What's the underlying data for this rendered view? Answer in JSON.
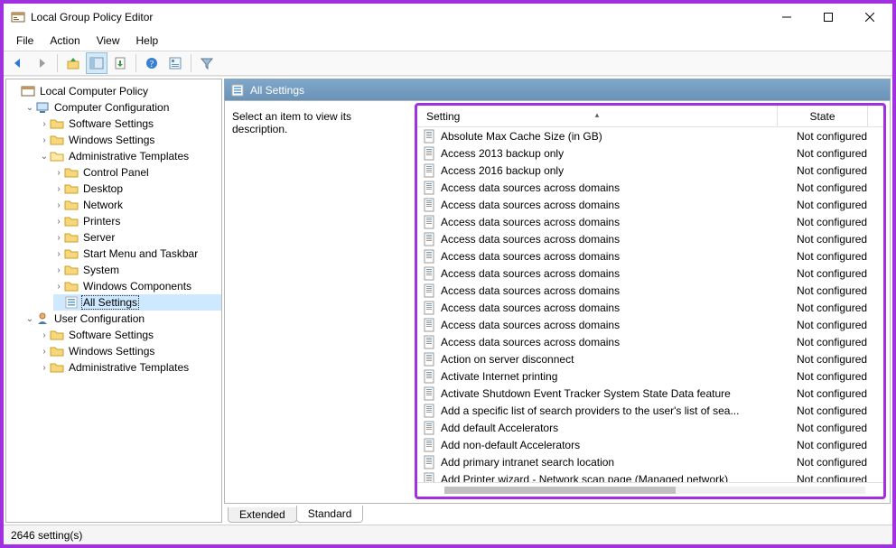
{
  "window": {
    "title": "Local Group Policy Editor"
  },
  "menu": [
    "File",
    "Action",
    "View",
    "Help"
  ],
  "tree": {
    "root": "Local Computer Policy",
    "cc": {
      "label": "Computer Configuration",
      "software": "Software Settings",
      "windows": "Windows Settings",
      "admin": {
        "label": "Administrative Templates",
        "children": [
          "Control Panel",
          "Desktop",
          "Network",
          "Printers",
          "Server",
          "Start Menu and Taskbar",
          "System",
          "Windows Components"
        ],
        "allsettings": "All Settings"
      }
    },
    "uc": {
      "label": "User Configuration",
      "software": "Software Settings",
      "windows": "Windows Settings",
      "admin": "Administrative Templates"
    }
  },
  "detail": {
    "header": "All Settings",
    "desc": "Select an item to view its description.",
    "col_setting": "Setting",
    "col_state": "State"
  },
  "rows": [
    {
      "s": "Absolute Max Cache Size (in GB)",
      "t": "Not configured"
    },
    {
      "s": "Access 2013 backup only",
      "t": "Not configured"
    },
    {
      "s": "Access 2016 backup only",
      "t": "Not configured"
    },
    {
      "s": "Access data sources across domains",
      "t": "Not configured"
    },
    {
      "s": "Access data sources across domains",
      "t": "Not configured"
    },
    {
      "s": "Access data sources across domains",
      "t": "Not configured"
    },
    {
      "s": "Access data sources across domains",
      "t": "Not configured"
    },
    {
      "s": "Access data sources across domains",
      "t": "Not configured"
    },
    {
      "s": "Access data sources across domains",
      "t": "Not configured"
    },
    {
      "s": "Access data sources across domains",
      "t": "Not configured"
    },
    {
      "s": "Access data sources across domains",
      "t": "Not configured"
    },
    {
      "s": "Access data sources across domains",
      "t": "Not configured"
    },
    {
      "s": "Access data sources across domains",
      "t": "Not configured"
    },
    {
      "s": "Action on server disconnect",
      "t": "Not configured"
    },
    {
      "s": "Activate Internet printing",
      "t": "Not configured"
    },
    {
      "s": "Activate Shutdown Event Tracker System State Data feature",
      "t": "Not configured"
    },
    {
      "s": "Add a specific list of search providers to the user's list of sea...",
      "t": "Not configured"
    },
    {
      "s": "Add default Accelerators",
      "t": "Not configured"
    },
    {
      "s": "Add non-default Accelerators",
      "t": "Not configured"
    },
    {
      "s": "Add primary intranet search location",
      "t": "Not configured"
    },
    {
      "s": "Add Printer wizard - Network scan page (Managed network)",
      "t": "Not configured"
    }
  ],
  "tabs": {
    "extended": "Extended",
    "standard": "Standard"
  },
  "status": "2646 setting(s)"
}
